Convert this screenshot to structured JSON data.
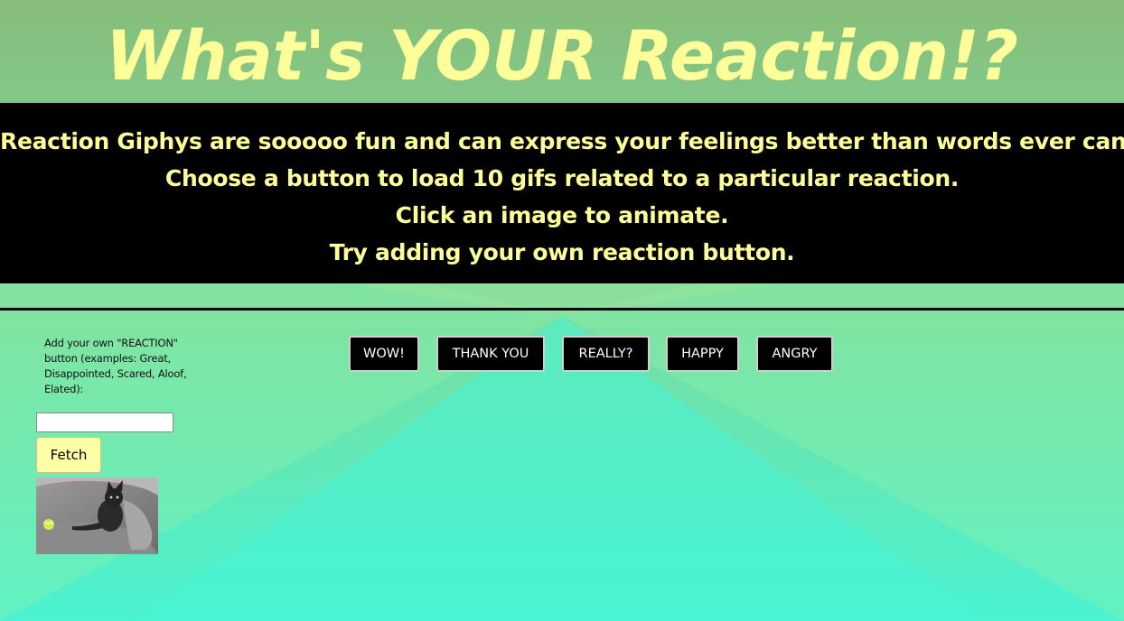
{
  "header": {
    "title": "What's YOUR Reaction!?"
  },
  "intro": {
    "lines": [
      "Reaction Giphys are sooooo fun and can express your feelings better than words ever can.",
      "Choose a button to load 10 gifs related to a particular reaction.",
      "Click an image to animate.",
      "Try adding your own reaction button."
    ]
  },
  "sidebar": {
    "add_label": "Add your own \"REACTION\" button (examples: Great, Disappointed, Scared, Aloof, Elated):",
    "input_value": "",
    "fetch_label": "Fetch"
  },
  "reaction_buttons": [
    {
      "label": "WOW!"
    },
    {
      "label": "THANK YOU"
    },
    {
      "label": "REALLY?"
    },
    {
      "label": "HAPPY"
    },
    {
      "label": "ANGRY"
    }
  ],
  "colors": {
    "accent_text": "#ffff99",
    "intro_background": "#000000",
    "button_background": "#000000",
    "fetch_background": "#ffffa8"
  }
}
